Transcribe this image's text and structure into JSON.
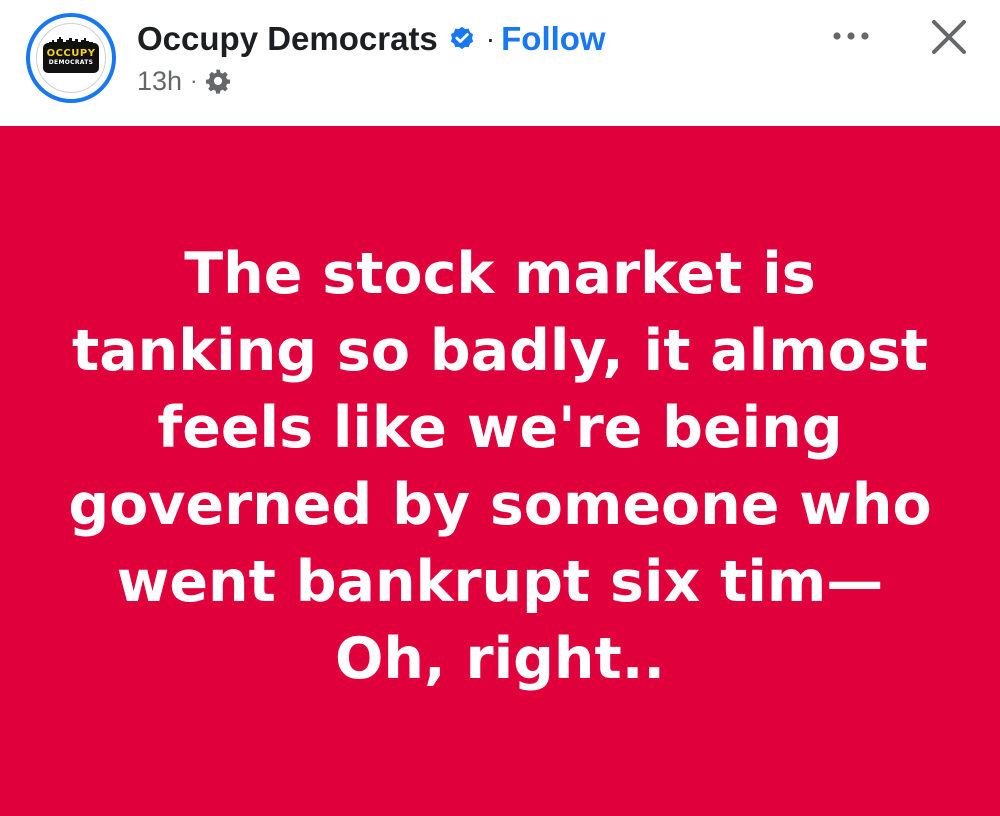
{
  "post": {
    "author": "Occupy Democrats",
    "follow_label": "Follow",
    "separator": "·",
    "time": "13h",
    "more_icon": "more-horizontal-icon",
    "close_icon": "close-icon",
    "privacy_icon": "gear-icon",
    "verified_icon": "verified-badge-icon",
    "logo": {
      "line1": "OCCUPY",
      "line2": "DEMOCRATS"
    },
    "background_color": "#e0003b",
    "text_color": "#ffffff",
    "accent_color": "#1877f2",
    "text_lines": [
      "The stock market is",
      "tanking so badly, it almost",
      "feels like we're being",
      "governed by someone who",
      "went bankrupt six tim—",
      "Oh, right.."
    ]
  }
}
